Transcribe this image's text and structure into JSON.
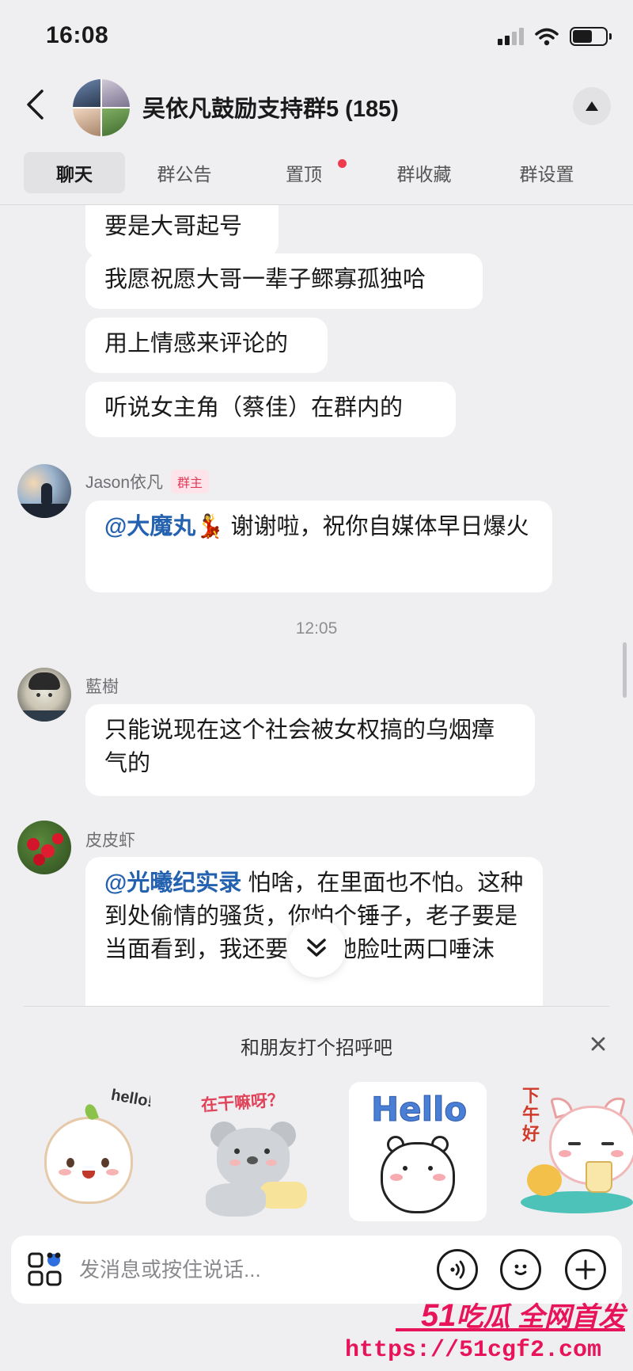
{
  "status_bar": {
    "time": "16:08",
    "battery_level": 0.6,
    "signal_bars": 2
  },
  "header": {
    "title": "吴依凡鼓励支持群5 (185)"
  },
  "tabs": [
    {
      "label": "聊天",
      "active": true,
      "has_dot": false
    },
    {
      "label": "群公告",
      "active": false,
      "has_dot": false
    },
    {
      "label": "置顶",
      "active": false,
      "has_dot": true
    },
    {
      "label": "群收藏",
      "active": false,
      "has_dot": false
    },
    {
      "label": "群设置",
      "active": false,
      "has_dot": false
    }
  ],
  "messages": {
    "m1": "要是大哥起号",
    "m2": "我愿祝愿大哥一辈子鳏寡孤独哈",
    "m3": "用上情感来评论的",
    "m4": "听说女主角（蔡佳）在群内的",
    "jason": {
      "sender": "Jason依凡",
      "badge": "群主",
      "mention": "@大魔丸",
      "emoji": "💃",
      "text": "谢谢啦，祝你自媒体早日爆火"
    },
    "time_divider": "12:05",
    "lanshu": {
      "sender": "藍樹",
      "text": "只能说现在这个社会被女权搞的乌烟瘴气的"
    },
    "pipixia": {
      "sender": "皮皮虾",
      "mention": "@光曦纪实录",
      "text": "怕啥，在里面也不怕。这种到处偷情的骚货，你怕个锤子，老子要是当面看到，我还要对着她脸吐两口唾沫"
    }
  },
  "greeting_panel": {
    "title": "和朋友打个招呼吧",
    "stickers": [
      {
        "name": "hello-sprout",
        "text": "hello!"
      },
      {
        "name": "koala-question",
        "text": "在干嘛呀？"
      },
      {
        "name": "bear-hello",
        "text": "Hello"
      },
      {
        "name": "cat-afternoon",
        "text": "下午好"
      }
    ]
  },
  "input": {
    "placeholder": "发消息或按住说话..."
  },
  "watermark": {
    "brand_number": "51",
    "brand_text": "吃瓜 全网首发",
    "url": "https://51cgf2.com"
  },
  "colors": {
    "mention": "#2462b0",
    "badge": "#e23a59",
    "watermark": "#e8145a",
    "dot": "#ef3a4e"
  }
}
